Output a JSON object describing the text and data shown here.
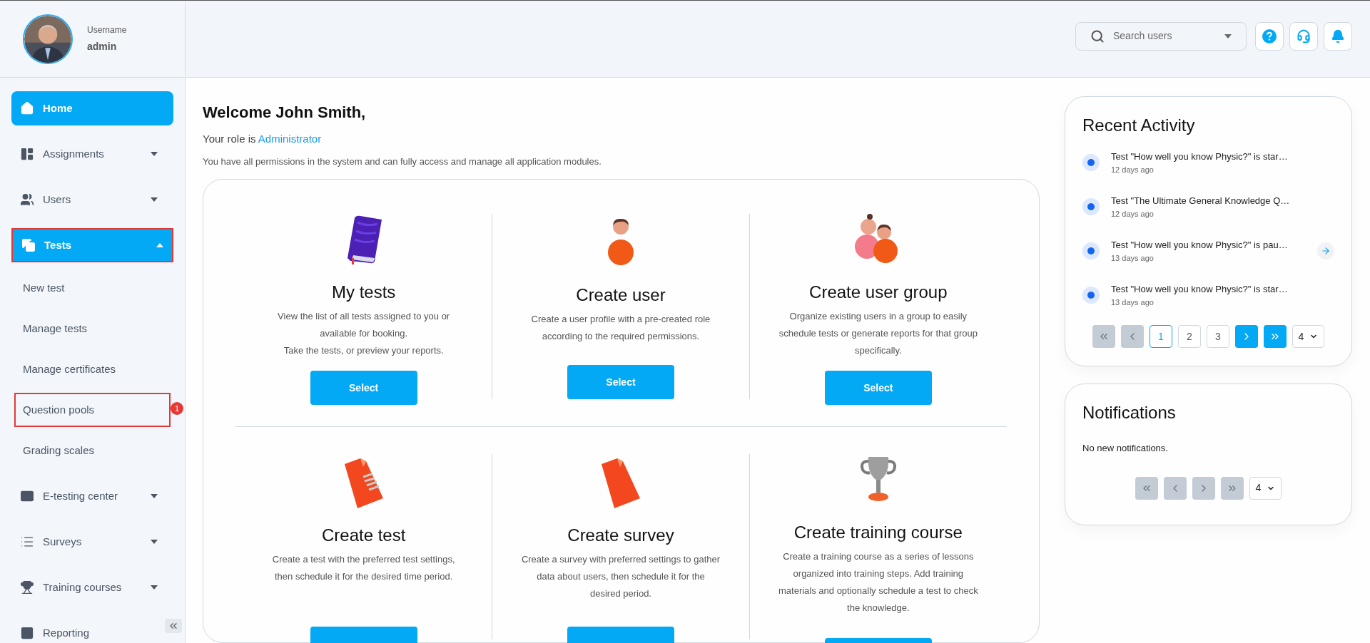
{
  "user": {
    "label": "Username",
    "name": "admin"
  },
  "sidebar": {
    "items": [
      {
        "label": "Home",
        "kind": "link",
        "selected": true
      },
      {
        "label": "Assignments",
        "kind": "group",
        "selected": false,
        "expanded": false
      },
      {
        "label": "Users",
        "kind": "group",
        "selected": false,
        "expanded": false
      },
      {
        "label": "Tests",
        "kind": "group",
        "selected": true,
        "expanded": true,
        "highlighted": true,
        "children": [
          {
            "label": "New test",
            "highlighted": false
          },
          {
            "label": "Manage tests",
            "highlighted": false
          },
          {
            "label": "Manage certificates",
            "highlighted": false
          },
          {
            "label": "Question pools",
            "highlighted": true,
            "badge": "1"
          },
          {
            "label": "Grading scales",
            "highlighted": false
          }
        ]
      },
      {
        "label": "E-testing center",
        "kind": "group",
        "selected": false,
        "expanded": false
      },
      {
        "label": "Surveys",
        "kind": "group",
        "selected": false,
        "expanded": false
      },
      {
        "label": "Training courses",
        "kind": "group",
        "selected": false,
        "expanded": false
      },
      {
        "label": "Reporting",
        "kind": "link",
        "selected": false
      }
    ]
  },
  "search": {
    "placeholder": "Search users"
  },
  "welcome": {
    "title": "Welcome John Smith,",
    "role_prefix": "Your role is",
    "role": "Administrator",
    "description": "You have all permissions in the system and can fully access and manage all application modules."
  },
  "cards": [
    {
      "kind": "book",
      "title": "My tests",
      "description": [
        "View the list of all tests assigned to you or available for booking.",
        "Take the tests, or preview your reports."
      ],
      "button": "Select"
    },
    {
      "kind": "person",
      "title": "Create user",
      "description": [
        "Create a user profile with a pre-created role according to the required permissions."
      ],
      "button": "Select"
    },
    {
      "kind": "people",
      "title": "Create user group",
      "description": [
        "Organize existing users in a group to easily schedule tests or generate reports for that group specifically."
      ],
      "button": "Select"
    },
    {
      "kind": "document",
      "title": "Create test",
      "description": [
        "Create a test with the preferred test settings, then schedule it for the desired time period."
      ]
    },
    {
      "kind": "survey",
      "title": "Create survey",
      "description": [
        "Create a survey with preferred settings to gather data about users, then schedule it for the desired period."
      ]
    },
    {
      "kind": "trophy",
      "title": "Create training course",
      "description": [
        "Create a training course as a series of lessons organized into training steps. Add training materials and optionally schedule a test to check the knowledge."
      ]
    }
  ],
  "recent_activity": {
    "title": "Recent Activity",
    "items": [
      {
        "text": "Test \"How well you know Physic?\" is star…",
        "time": "12 days ago",
        "has_action": false
      },
      {
        "text": "Test \"The Ultimate General Knowledge Q…",
        "time": "12 days ago",
        "has_action": false
      },
      {
        "text": "Test \"How well you know Physic?\" is pau…",
        "time": "13 days ago",
        "has_action": true
      },
      {
        "text": "Test \"How well you know Physic?\" is star…",
        "time": "13 days ago",
        "has_action": false
      }
    ],
    "pagination": {
      "first_disabled": true,
      "prev_disabled": true,
      "next_disabled": false,
      "last_disabled": false,
      "pages": [
        {
          "label": "1",
          "selected": true
        },
        {
          "label": "2",
          "selected": false
        },
        {
          "label": "3",
          "selected": false
        }
      ],
      "page_size": "4"
    }
  },
  "notifications": {
    "title": "Notifications",
    "empty_text": "No new notifications.",
    "pagination": {
      "first_disabled": true,
      "prev_disabled": true,
      "next_disabled": true,
      "last_disabled": true,
      "page_size": "4"
    }
  }
}
